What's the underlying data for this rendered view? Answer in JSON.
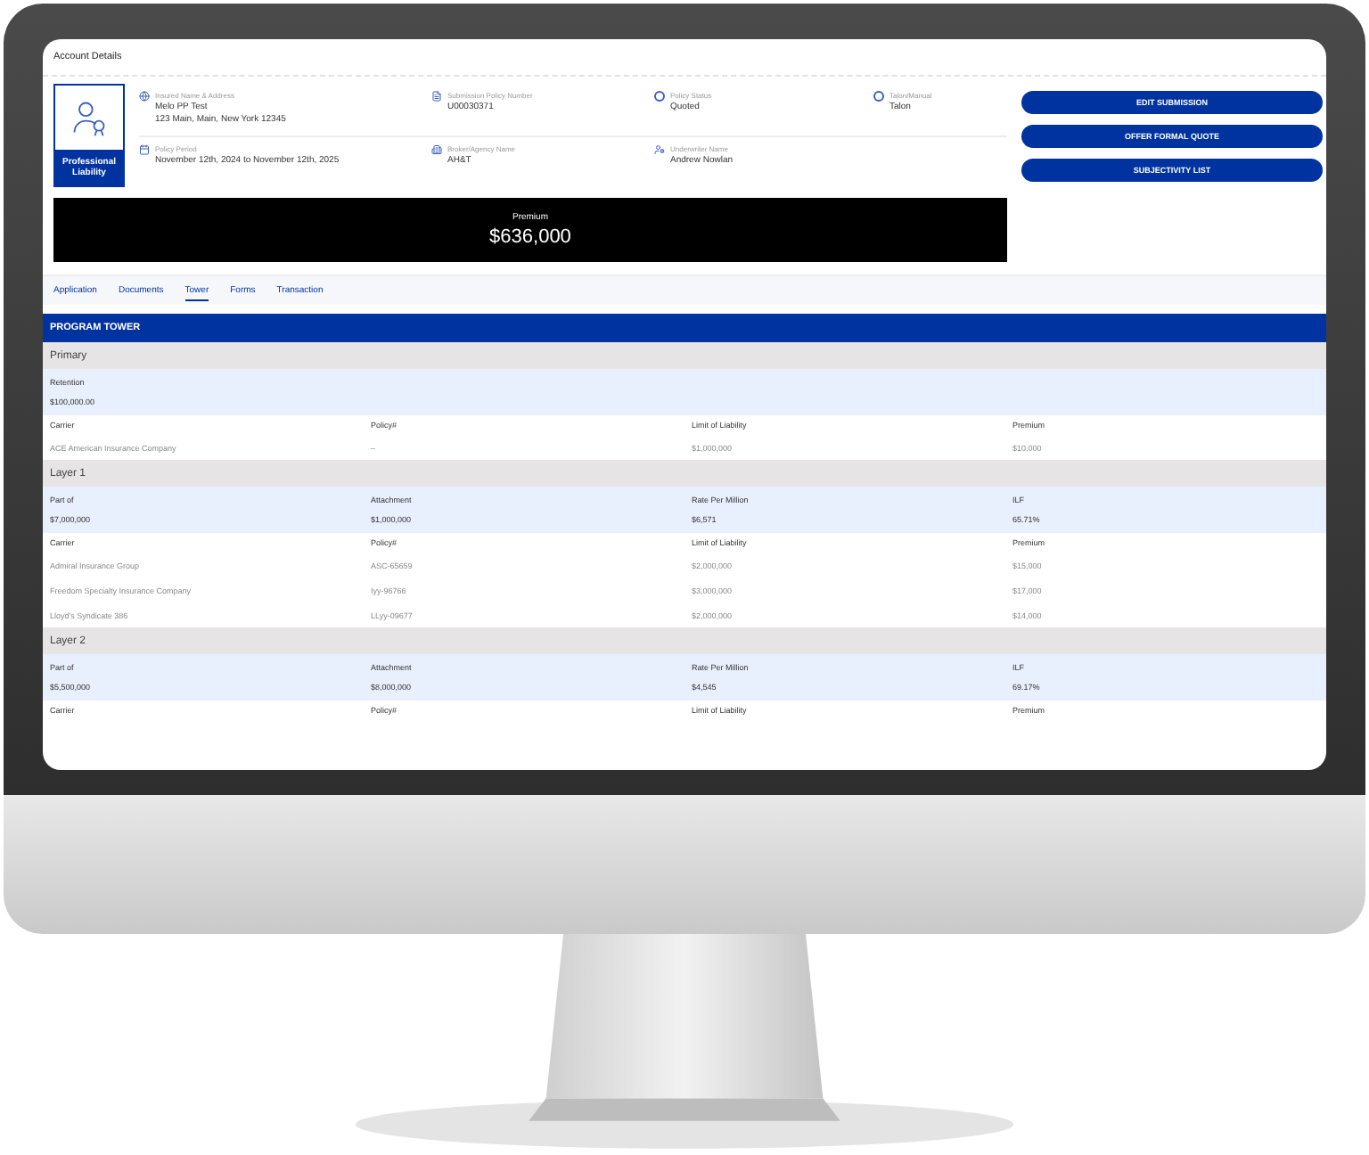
{
  "window": {
    "title": "Account Details"
  },
  "product": {
    "label": "Professional Liability"
  },
  "fields": [
    {
      "kind": "globe",
      "label": "Insured Name & Address",
      "lines": [
        "Melo PP Test",
        "123 Main, Main, New York 12345"
      ]
    },
    {
      "kind": "document",
      "label": "Submission Policy Number",
      "lines": [
        "U00030371"
      ]
    },
    {
      "kind": "ring",
      "label": "Policy Status",
      "lines": [
        "Quoted"
      ]
    },
    {
      "kind": "ring",
      "label": "Talon/Manual",
      "lines": [
        "Talon"
      ]
    },
    {
      "kind": "calendar",
      "label": "Policy Period",
      "lines": [
        "November 12th, 2024 to November 12th, 2025"
      ]
    },
    {
      "kind": "building",
      "label": "Broker/Agency Name",
      "lines": [
        "AH&T"
      ]
    },
    {
      "kind": "user",
      "label": "Underwriter Name",
      "lines": [
        "Andrew Nowlan"
      ]
    }
  ],
  "buttons": [
    "EDIT SUBMISSION",
    "OFFER FORMAL QUOTE",
    "SUBJECTIVITY LIST"
  ],
  "premium": {
    "label": "Premium",
    "value": "$636,000"
  },
  "tabs": [
    {
      "label": "Application",
      "selected": false
    },
    {
      "label": "Documents",
      "selected": false
    },
    {
      "label": "Tower",
      "selected": true
    },
    {
      "label": "Forms",
      "selected": false
    },
    {
      "label": "Transaction",
      "selected": false
    }
  ],
  "tower": {
    "title": "PROGRAM TOWER",
    "sections": [
      {
        "title": "Primary",
        "summary": [
          {
            "label": "Retention",
            "value": "$100,000.00"
          }
        ],
        "columns": [
          "Carrier",
          "Policy#",
          "Limit of Liability",
          "Premium"
        ],
        "rows": [
          [
            "ACE American Insurance Company",
            "–",
            "$1,000,000",
            "$10,000"
          ]
        ]
      },
      {
        "title": "Layer 1",
        "summary": [
          {
            "label": "Part of",
            "value": "$7,000,000"
          },
          {
            "label": "Attachment",
            "value": "$1,000,000"
          },
          {
            "label": "Rate Per Million",
            "value": "$6,571"
          },
          {
            "label": "ILF",
            "value": "65.71%"
          }
        ],
        "columns": [
          "Carrier",
          "Policy#",
          "Limit of Liability",
          "Premium"
        ],
        "rows": [
          [
            "Admiral Insurance Group",
            "ASC-65659",
            "$2,000,000",
            "$15,000"
          ],
          [
            "Freedom Specialty Insurance Company",
            "Iyy-96766",
            "$3,000,000",
            "$17,000"
          ],
          [
            "Lloyd's Syndicate 386",
            "LLyy-09677",
            "$2,000,000",
            "$14,000"
          ]
        ]
      },
      {
        "title": "Layer 2",
        "summary": [
          {
            "label": "Part of",
            "value": "$5,500,000"
          },
          {
            "label": "Attachment",
            "value": "$8,000,000"
          },
          {
            "label": "Rate Per Million",
            "value": "$4,545"
          },
          {
            "label": "ILF",
            "value": "69.17%"
          }
        ],
        "columns": [
          "Carrier",
          "Policy#",
          "Limit of Liability",
          "Premium"
        ]
      }
    ]
  }
}
